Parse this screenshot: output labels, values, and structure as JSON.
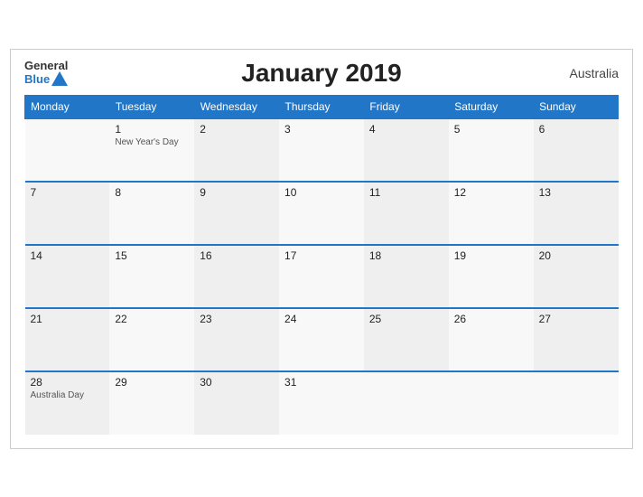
{
  "header": {
    "title": "January 2019",
    "country": "Australia"
  },
  "logo": {
    "line1": "General",
    "line2": "Blue"
  },
  "days_of_week": [
    "Monday",
    "Tuesday",
    "Wednesday",
    "Thursday",
    "Friday",
    "Saturday",
    "Sunday"
  ],
  "weeks": [
    [
      {
        "day": "",
        "event": ""
      },
      {
        "day": "1",
        "event": "New Year's Day"
      },
      {
        "day": "2",
        "event": ""
      },
      {
        "day": "3",
        "event": ""
      },
      {
        "day": "4",
        "event": ""
      },
      {
        "day": "5",
        "event": ""
      },
      {
        "day": "6",
        "event": ""
      }
    ],
    [
      {
        "day": "7",
        "event": ""
      },
      {
        "day": "8",
        "event": ""
      },
      {
        "day": "9",
        "event": ""
      },
      {
        "day": "10",
        "event": ""
      },
      {
        "day": "11",
        "event": ""
      },
      {
        "day": "12",
        "event": ""
      },
      {
        "day": "13",
        "event": ""
      }
    ],
    [
      {
        "day": "14",
        "event": ""
      },
      {
        "day": "15",
        "event": ""
      },
      {
        "day": "16",
        "event": ""
      },
      {
        "day": "17",
        "event": ""
      },
      {
        "day": "18",
        "event": ""
      },
      {
        "day": "19",
        "event": ""
      },
      {
        "day": "20",
        "event": ""
      }
    ],
    [
      {
        "day": "21",
        "event": ""
      },
      {
        "day": "22",
        "event": ""
      },
      {
        "day": "23",
        "event": ""
      },
      {
        "day": "24",
        "event": ""
      },
      {
        "day": "25",
        "event": ""
      },
      {
        "day": "26",
        "event": ""
      },
      {
        "day": "27",
        "event": ""
      }
    ],
    [
      {
        "day": "28",
        "event": "Australia Day"
      },
      {
        "day": "29",
        "event": ""
      },
      {
        "day": "30",
        "event": ""
      },
      {
        "day": "31",
        "event": ""
      },
      {
        "day": "",
        "event": ""
      },
      {
        "day": "",
        "event": ""
      },
      {
        "day": "",
        "event": ""
      }
    ]
  ]
}
